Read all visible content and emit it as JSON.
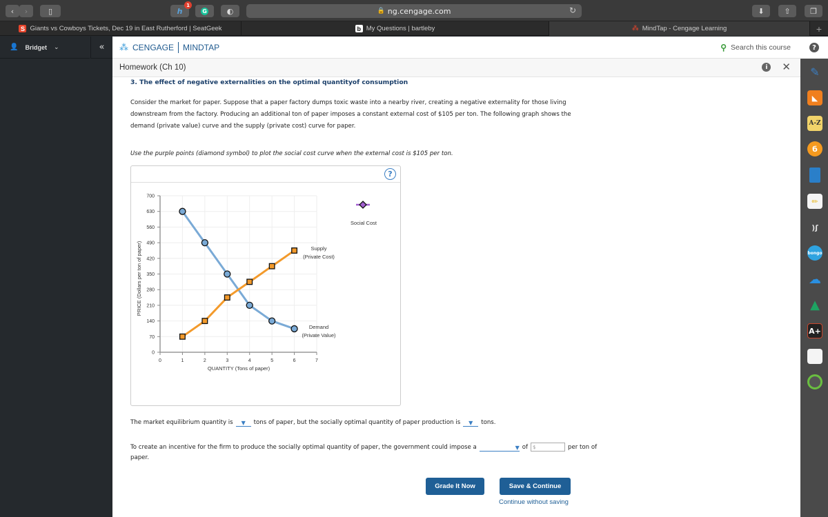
{
  "browser": {
    "url": "ng.cengage.com",
    "extension_badge": "1",
    "tabs": [
      {
        "label": "Giants vs Cowboys Tickets, Dec 19 in East Rutherford | SeatGeek",
        "favicon": "S",
        "favicon_color": "#e8452c"
      },
      {
        "label": "My Questions | bartleby",
        "favicon": "b",
        "favicon_color": "#ffffff"
      },
      {
        "label": "MindTap - Cengage Learning",
        "favicon": "mindtap-logo",
        "favicon_color": "#e8452c",
        "active": true
      }
    ],
    "new_tab_label": "+"
  },
  "sidebar": {
    "user_name": "Bridget",
    "collapse_label": "«"
  },
  "header": {
    "brand_left": "CENGAGE",
    "brand_right": "MINDTAP",
    "search_label": "Search this course",
    "help_label": "?"
  },
  "activity": {
    "title": "Homework (Ch 10)",
    "question_title": "3. The effect of negative externalities on the optimal quantityof consumption",
    "paragraph": "Consider the market for paper. Suppose that a paper factory dumps toxic waste into a nearby river, creating a negative externality for those living downstream from the factory. Producing an additional ton of paper imposes a constant external cost of $105 per ton. The following graph shows the demand (private value) curve and the supply (private cost) curve for paper.",
    "instruction": "Use the purple points (diamond symbol) to plot the social cost curve when the external cost is $105 per ton.",
    "graph_help": "?",
    "line1_a": "The market equilibrium quantity is",
    "line1_b": "tons of paper, but the socially optimal quantity of paper production is",
    "line1_c": "tons.",
    "line2_a": "To create an incentive for the firm to produce the socially optimal quantity of paper, the government could impose a",
    "line2_b": "of",
    "line2_input_placeholder": "$",
    "line2_c": "per ton of",
    "line3": "paper.",
    "grade_button": "Grade It Now",
    "save_button": "Save & Continue",
    "continue_link": "Continue without saving"
  },
  "rail_icons": [
    "highlighter",
    "rss",
    "a-z",
    "b-circle",
    "book",
    "notebook",
    "read-speaker",
    "bongo",
    "onedrive",
    "google-drive",
    "aplus",
    "flashcards",
    "progress"
  ],
  "chart_data": {
    "type": "line",
    "xlabel": "QUANTITY (Tons of paper)",
    "ylabel": "PRICE (Dollars per ton of paper)",
    "xlim": [
      0,
      7
    ],
    "ylim": [
      0,
      700
    ],
    "xticks": [
      "0",
      "1",
      "2",
      "3",
      "4",
      "5",
      "6",
      "7"
    ],
    "yticks": [
      "0",
      "70",
      "140",
      "210",
      "280",
      "350",
      "420",
      "490",
      "560",
      "630",
      "700"
    ],
    "grid": true,
    "series": [
      {
        "name": "Demand (Private Value)",
        "label_line1": "Demand",
        "label_line2": "(Private Value)",
        "marker": "circle",
        "color": "#7aaad6",
        "x": [
          1,
          2,
          3,
          4,
          5,
          6
        ],
        "y": [
          630,
          490,
          350,
          210,
          140,
          105
        ]
      },
      {
        "name": "Supply (Private Cost)",
        "label_line1": "Supply",
        "label_line2": "(Private Cost)",
        "marker": "square",
        "color": "#f39a2b",
        "x": [
          1,
          2,
          3,
          4,
          5,
          6
        ],
        "y": [
          70,
          140,
          245,
          315,
          385,
          455
        ]
      }
    ],
    "palette_tool": {
      "name": "Social Cost",
      "marker": "diamond",
      "color": "#a25fd0"
    }
  }
}
